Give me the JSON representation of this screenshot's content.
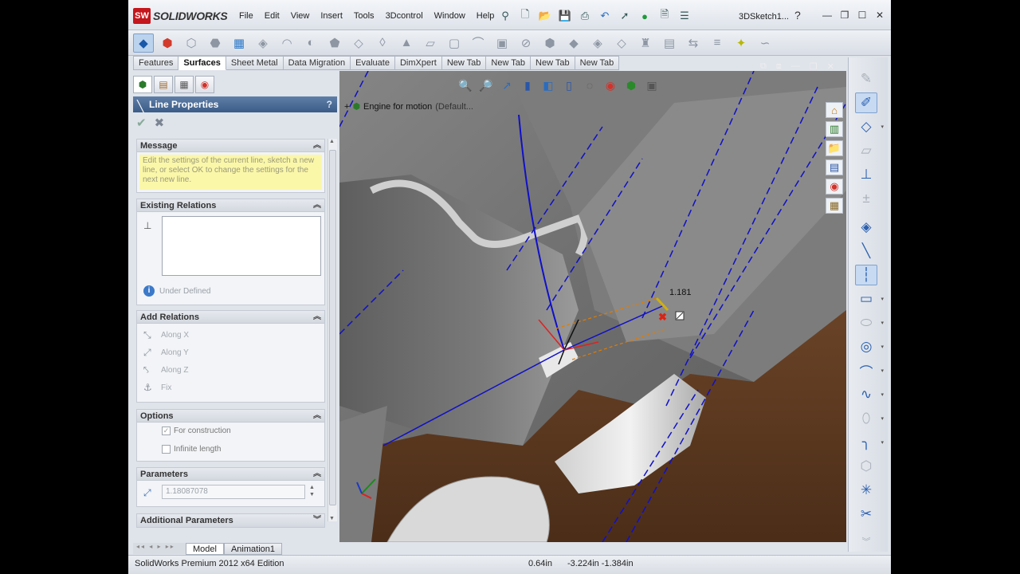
{
  "app": {
    "logo_mark": "SW",
    "logo_word": "SOLIDWORKS",
    "document_title": "3DSketch1...",
    "menus": [
      "File",
      "Edit",
      "View",
      "Insert",
      "Tools",
      "3Dcontrol",
      "Window",
      "Help"
    ]
  },
  "tabs": [
    "Features",
    "Surfaces",
    "Sheet Metal",
    "Data Migration",
    "Evaluate",
    "DimXpert",
    "New Tab",
    "New Tab",
    "New Tab",
    "New Tab"
  ],
  "active_tab": "Surfaces",
  "panel": {
    "title": "Line Properties",
    "help": "?",
    "message": {
      "header": "Message",
      "text": "Edit the settings of the current line, sketch a new line, or select OK to change the settings for the next new line."
    },
    "existing_relations": {
      "header": "Existing Relations",
      "status": "Under Defined"
    },
    "add_relations": {
      "header": "Add Relations",
      "items": [
        "Along X",
        "Along Y",
        "Along Z",
        "Fix"
      ]
    },
    "options": {
      "header": "Options",
      "for_construction": "For construction",
      "infinite_length": "Infinite length",
      "for_construction_checked": true,
      "infinite_length_checked": false
    },
    "parameters": {
      "header": "Parameters",
      "length_value": "1.18087078"
    },
    "additional_parameters": {
      "header": "Additional Parameters"
    }
  },
  "viewport": {
    "tree_item": "Engine for motion",
    "tree_config": "(Default..."
  },
  "sketch_dimension": "1.181",
  "bottom_tabs": [
    "Model",
    "Animation1"
  ],
  "active_bottom_tab": "Model",
  "status": {
    "edition": "SolidWorks Premium 2012 x64 Edition",
    "length": "0.64in",
    "coords": "-3.224in -1.384in"
  },
  "colors": {
    "sketch_line": "#1010c8",
    "brand_red": "#c4161c",
    "panel_header": "#3b5c87",
    "message_bg": "#fbf7a9"
  }
}
